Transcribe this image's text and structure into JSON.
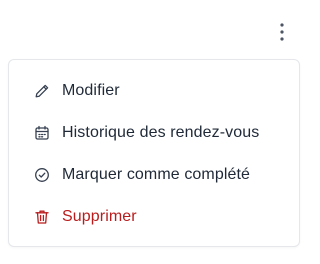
{
  "menu": {
    "trigger_icon": "more-vertical-icon",
    "items": [
      {
        "label": "Modifier",
        "icon": "pencil-icon",
        "color": "#1f2937"
      },
      {
        "label": "Historique des rendez-vous",
        "icon": "calendar-icon",
        "color": "#1f2937"
      },
      {
        "label": "Marquer comme complété",
        "icon": "check-circle-icon",
        "color": "#1f2937"
      },
      {
        "label": "Supprimer",
        "icon": "trash-icon",
        "color": "#b91c1c"
      }
    ]
  }
}
